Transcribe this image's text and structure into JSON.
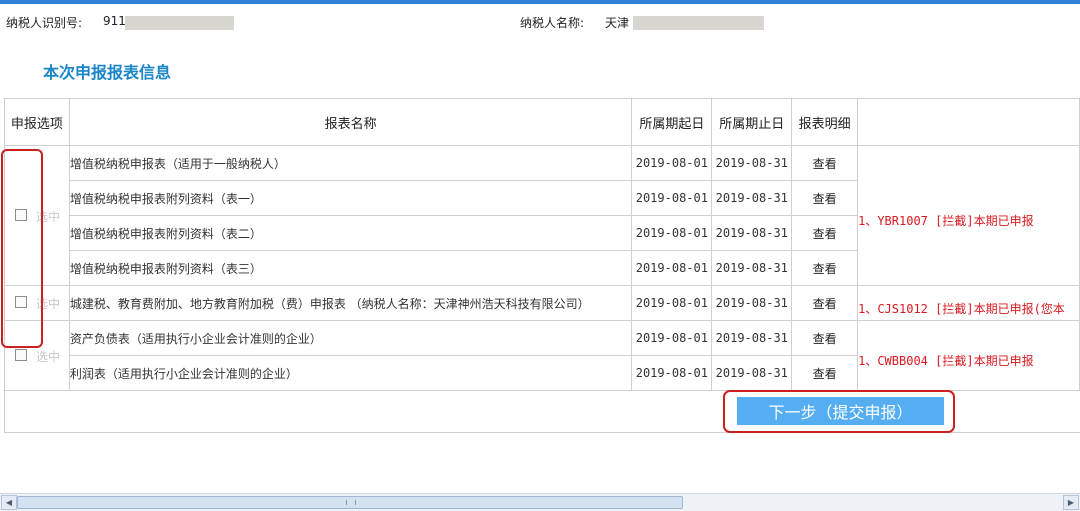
{
  "taxpayer": {
    "id_label": "纳税人识别号:",
    "id_value": "911",
    "name_label": "纳税人名称:",
    "name_value": "天津"
  },
  "section_title": "本次申报报表信息",
  "table": {
    "headers": [
      "申报选项",
      "报表名称",
      "所属期起日",
      "所属期止日",
      "报表明细",
      ""
    ],
    "select_label": "选中",
    "detail_label": "查看",
    "rows": [
      {
        "name": "增值税纳税申报表（适用于一般纳税人）",
        "start": "2019-08-01",
        "end": "2019-08-31"
      },
      {
        "name": "增值税纳税申报表附列资料（表一）",
        "start": "2019-08-01",
        "end": "2019-08-31"
      },
      {
        "name": "增值税纳税申报表附列资料（表二）",
        "start": "2019-08-01",
        "end": "2019-08-31"
      },
      {
        "name": "增值税纳税申报表附列资料（表三）",
        "start": "2019-08-01",
        "end": "2019-08-31"
      },
      {
        "name": "城建税、教育费附加、地方教育附加税（费）申报表 （纳税人名称：天津神州浩天科技有限公司）",
        "start": "2019-08-01",
        "end": "2019-08-31"
      },
      {
        "name": "资产负债表（适用执行小企业会计准则的企业）",
        "start": "2019-08-01",
        "end": "2019-08-31"
      },
      {
        "name": "利润表（适用执行小企业会计准则的企业）",
        "start": "2019-08-01",
        "end": "2019-08-31"
      }
    ],
    "messages": [
      "1、YBR1007 [拦截]本期已申报",
      "1、CJS1012 [拦截]本期已申报(您本",
      "1、CWBB004 [拦截]本期已申报"
    ]
  },
  "next_button_label": "下一步（提交申报）",
  "colors": {
    "accent": "#1a86c8",
    "error": "#d8191f",
    "button": "#55aef2",
    "highlight_box": "#cc1f1f"
  }
}
